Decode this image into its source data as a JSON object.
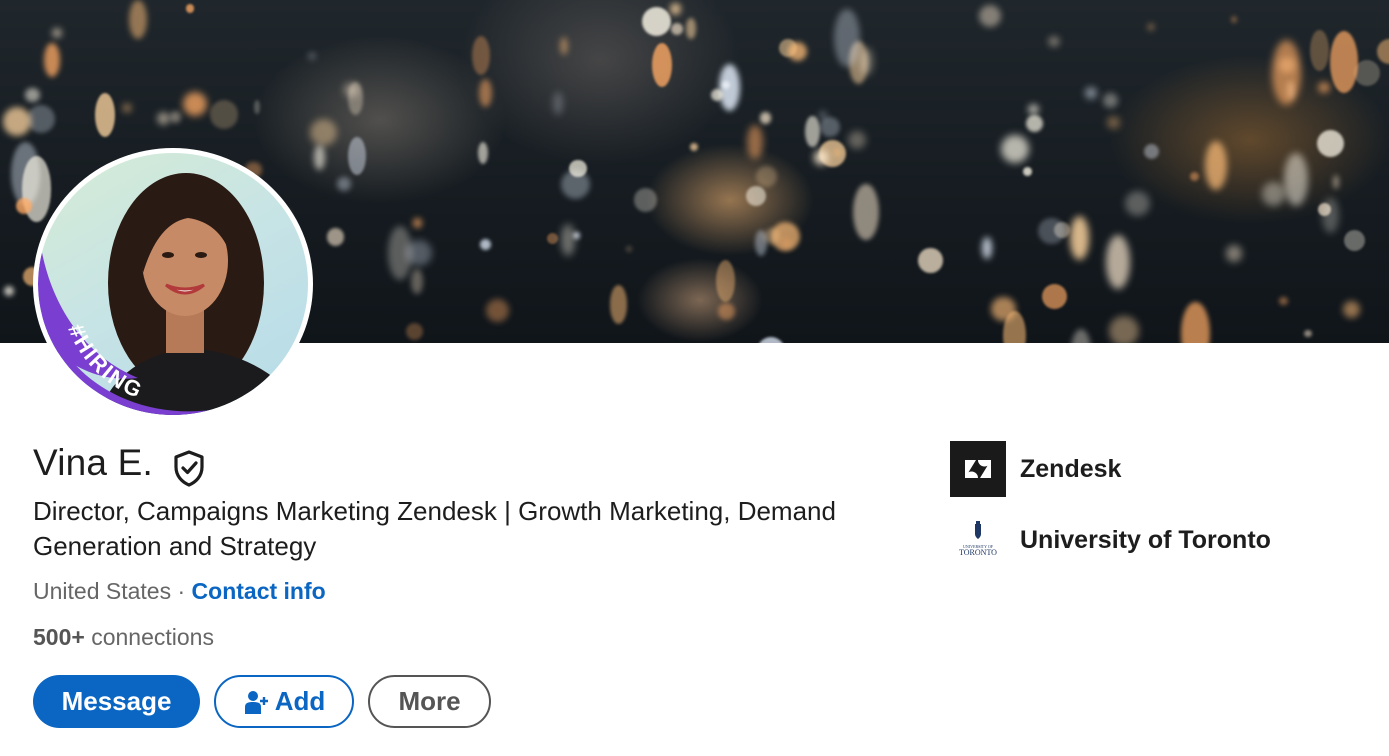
{
  "profile": {
    "name": "Vina E.",
    "badge_text": "#HIRING",
    "headline": "Director, Campaigns Marketing Zendesk | Growth Marketing, Demand Generation and Strategy",
    "location": "United States",
    "separator": "·",
    "contact_link": "Contact info",
    "connections_count": "500+",
    "connections_label": "connections"
  },
  "actions": {
    "message": "Message",
    "add": "Add",
    "more": "More"
  },
  "organizations": [
    {
      "name": "Zendesk",
      "logo_icon": "zendesk-logo-icon"
    },
    {
      "name": "University of Toronto",
      "logo_icon": "university-of-toronto-crest-icon",
      "logo_text": "TORONTO"
    }
  ],
  "colors": {
    "primary": "#0a66c2",
    "hiring_ring": "#7a3fd1",
    "text": "#1d1d1d",
    "muted": "#666666"
  }
}
